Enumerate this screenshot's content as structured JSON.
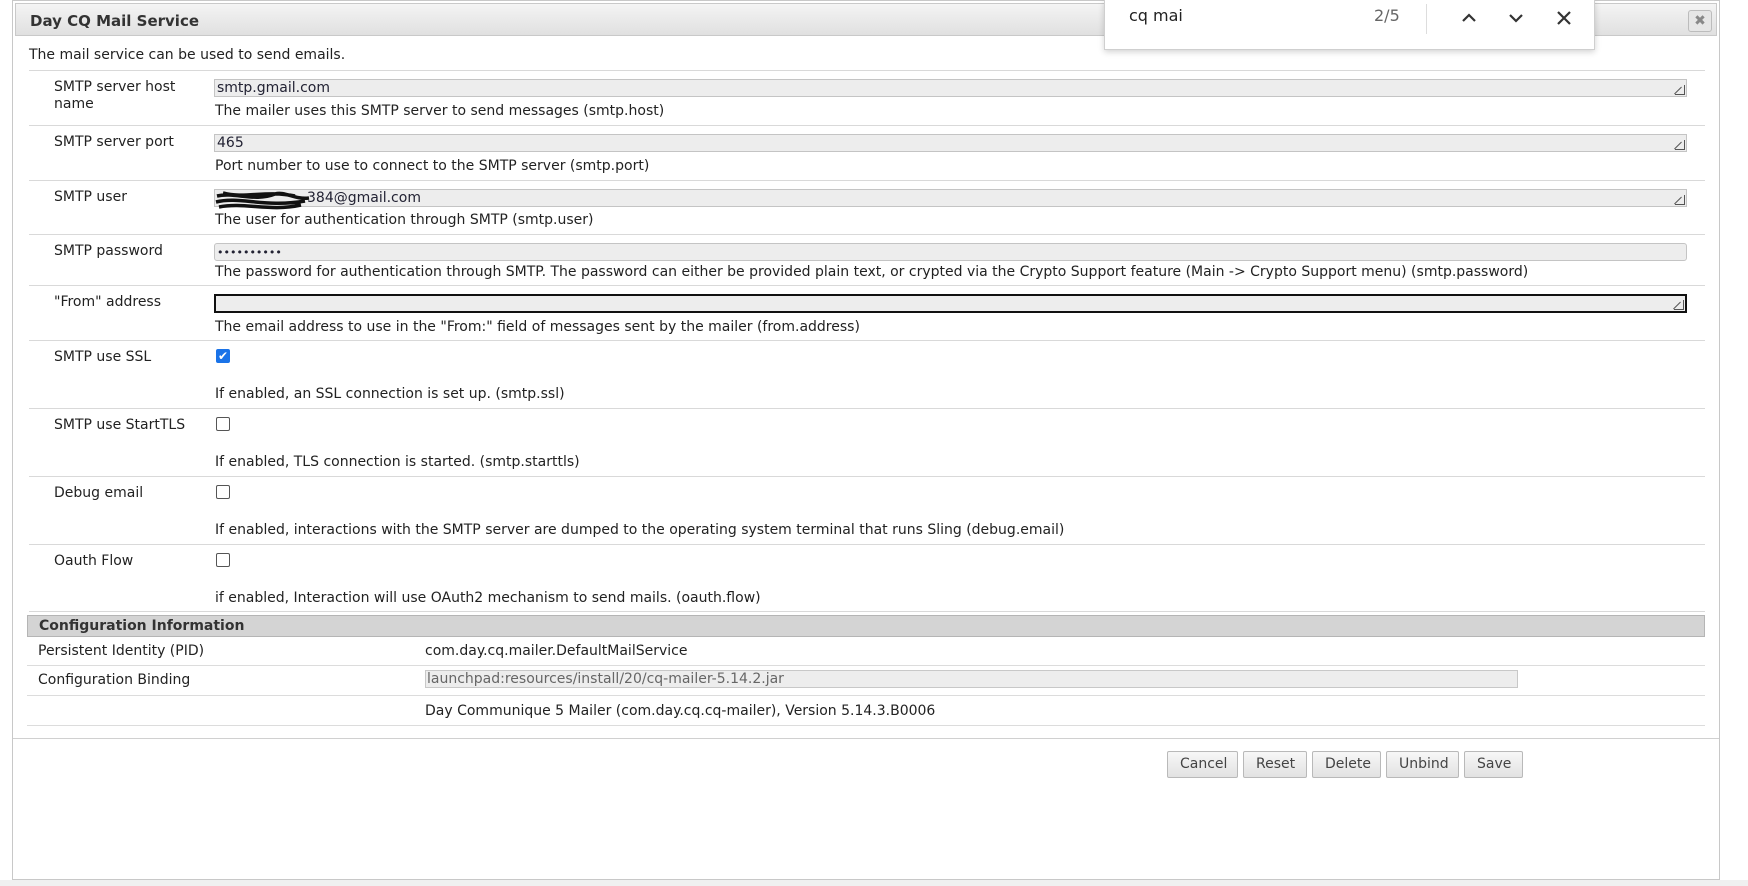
{
  "dialog": {
    "title": "Day CQ Mail Service",
    "description": "The mail service can be used to send emails."
  },
  "fields": {
    "host": {
      "label": "SMTP server host name",
      "value": "smtp.gmail.com",
      "help": "The mailer uses this SMTP server to send messages (smtp.host)"
    },
    "port": {
      "label": "SMTP server port",
      "value": "465",
      "help": "Port number to use to connect to the SMTP server (smtp.port)"
    },
    "user": {
      "label": "SMTP user",
      "value": "384@gmail.com",
      "help": "The user for authentication through SMTP (smtp.user)"
    },
    "password": {
      "label": "SMTP password",
      "value": "••••••••••",
      "help": "The password for authentication through SMTP. The password can either be provided plain text, or crypted via the Crypto Support feature (Main -> Crypto Support menu) (smtp.password)"
    },
    "from": {
      "label": "\"From\" address",
      "value": "",
      "help": "The email address to use in the \"From:\" field of messages sent by the mailer (from.address)"
    },
    "ssl": {
      "label": "SMTP use SSL",
      "checked": true,
      "help": "If enabled, an SSL connection is set up. (smtp.ssl)"
    },
    "starttls": {
      "label": "SMTP use StartTLS",
      "checked": false,
      "help": "If enabled, TLS connection is started. (smtp.starttls)"
    },
    "debug": {
      "label": "Debug email",
      "checked": false,
      "help": "If enabled, interactions with the SMTP server are dumped to the operating system terminal that runs Sling (debug.email)"
    },
    "oauth": {
      "label": "Oauth Flow",
      "checked": false,
      "help": "if enabled, Interaction will use OAuth2 mechanism to send mails. (oauth.flow)"
    }
  },
  "config_info": {
    "header": "Configuration Information",
    "pid_label": "Persistent Identity (PID)",
    "pid_value": "com.day.cq.mailer.DefaultMailService",
    "binding_label": "Configuration Binding",
    "binding_value": "launchpad:resources/install/20/cq-mailer-5.14.2.jar",
    "bundle_value": "Day Communique 5 Mailer (com.day.cq.cq-mailer), Version 5.14.3.B0006"
  },
  "buttons": {
    "cancel": "Cancel",
    "reset": "Reset",
    "delete": "Delete",
    "unbind": "Unbind",
    "save": "Save"
  },
  "find_bar": {
    "query": "cq mai",
    "count": "2/5"
  },
  "icons": {
    "close_dialog": "close-x-icon",
    "find_prev": "chevron-up-icon",
    "find_next": "chevron-down-icon",
    "find_close": "close-icon",
    "checkbox_checked": "checkmark-icon"
  },
  "colors": {
    "accent": "#1a73e8",
    "header_bg": "#d4d4d4"
  }
}
